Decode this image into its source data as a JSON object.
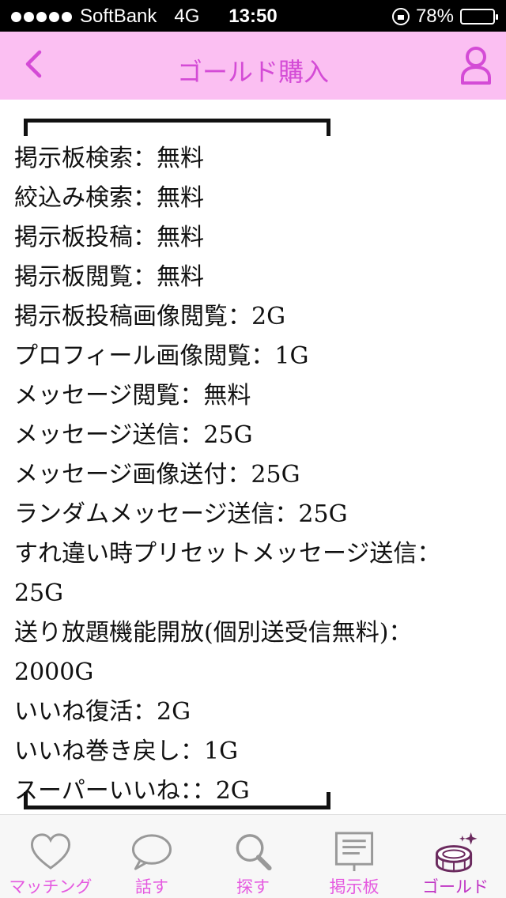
{
  "status_bar": {
    "carrier": "SoftBank",
    "network": "4G",
    "time": "13:50",
    "battery": "78%",
    "battery_level": 0.78
  },
  "nav": {
    "title": "ゴールド購入",
    "back_icon": "chevron-left-icon",
    "profile_icon": "person-icon"
  },
  "colors": {
    "nav_background": "#fbbff2",
    "accent": "#d44bd6",
    "tab_label": "#e55ae0"
  },
  "price_list": [
    "掲示板検索：無料",
    "絞込み検索：無料",
    "掲示板投稿：無料",
    "掲示板閲覧：無料",
    "掲示板投稿画像閲覧：2G",
    "プロフィール画像閲覧：1G",
    "メッセージ閲覧：無料",
    "メッセージ送信：25G",
    "メッセージ画像送付：25G",
    "ランダムメッセージ送信：25G",
    "すれ違い時プリセットメッセージ送信：25G",
    "送り放題機能開放(個別送受信無料)：2000G",
    "いいね復活：2G",
    "いいね巻き戻し：1G",
    "スーパーいいね：：2G"
  ],
  "tabs": [
    {
      "label": "マッチング",
      "icon": "heart-icon"
    },
    {
      "label": "話す",
      "icon": "speech-bubble-icon"
    },
    {
      "label": "探す",
      "icon": "search-icon"
    },
    {
      "label": "掲示板",
      "icon": "board-icon"
    },
    {
      "label": "ゴールド",
      "icon": "gold-coin-icon",
      "active": true
    }
  ]
}
